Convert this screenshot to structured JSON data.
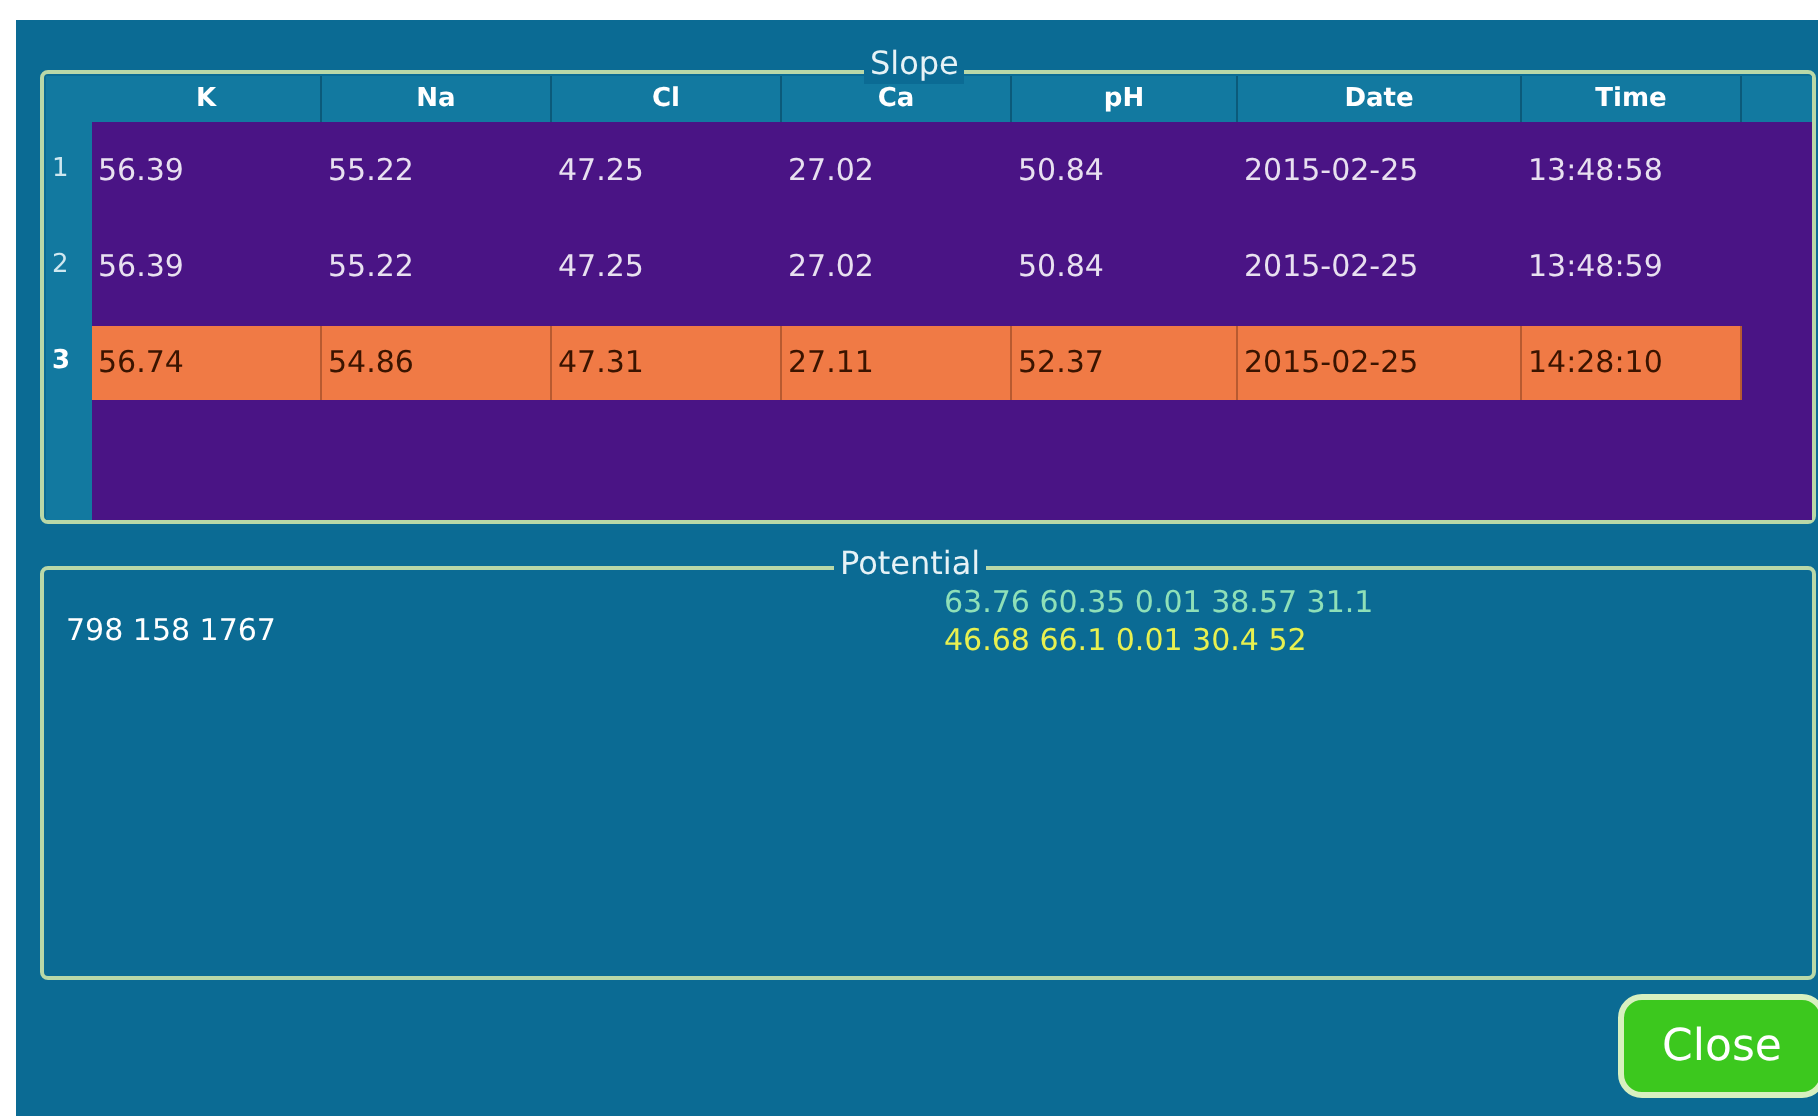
{
  "slope": {
    "title": "Slope",
    "columns": [
      "K",
      "Na",
      "Cl",
      "Ca",
      "pH",
      "Date",
      "Time"
    ],
    "rows": [
      {
        "number": "1",
        "selected": false,
        "cells": [
          "56.39",
          "55.22",
          "47.25",
          "27.02",
          "50.84",
          "2015-02-25",
          "13:48:58"
        ]
      },
      {
        "number": "2",
        "selected": false,
        "cells": [
          "56.39",
          "55.22",
          "47.25",
          "27.02",
          "50.84",
          "2015-02-25",
          "13:48:59"
        ]
      },
      {
        "number": "3",
        "selected": true,
        "cells": [
          "56.74",
          "54.86",
          "47.31",
          "27.11",
          "52.37",
          "2015-02-25",
          "14:28:10"
        ]
      }
    ]
  },
  "potential": {
    "title": "Potential",
    "summary": "798 158 1767",
    "lines": [
      {
        "text": "63.76 60.35 0.01 38.57 31.1",
        "color": "#8fe0b8"
      },
      {
        "text": "46.68 66.1 0.01 30.4 52",
        "color": "#e8f050"
      }
    ]
  },
  "buttons": [
    "Close"
  ]
}
